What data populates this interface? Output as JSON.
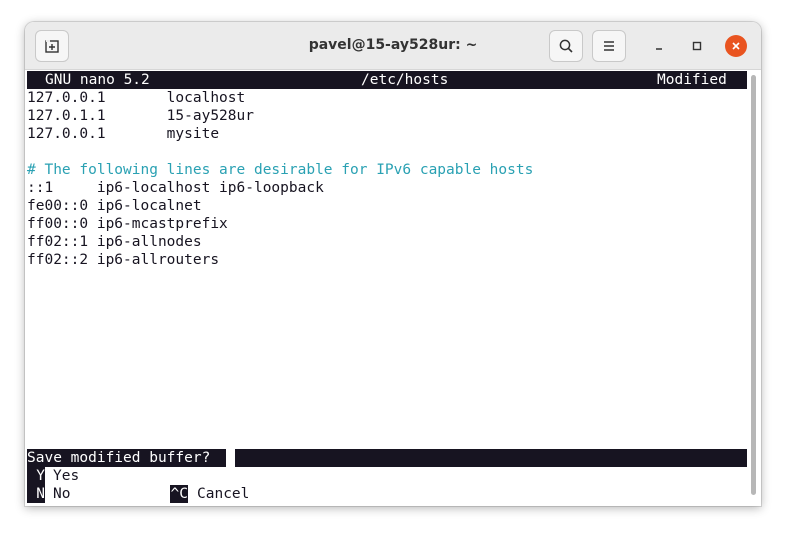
{
  "window": {
    "title": "pavel@15-ay528ur: ~"
  },
  "nano": {
    "version": "GNU nano 5.2",
    "filename": "/etc/hosts",
    "status": "Modified",
    "lines": [
      "127.0.0.1       localhost",
      "127.0.1.1       15-ay528ur",
      "127.0.0.1       mysite",
      "",
      "# The following lines are desirable for IPv6 capable hosts",
      "::1     ip6-localhost ip6-loopback",
      "fe00::0 ip6-localnet",
      "ff00::0 ip6-mcastprefix",
      "ff02::1 ip6-allnodes",
      "ff02::2 ip6-allrouters"
    ],
    "prompt": "Save modified buffer?",
    "options": [
      {
        "key": "Y",
        "label": "Yes"
      },
      {
        "key": "N",
        "label": "No"
      },
      {
        "key": "^C",
        "label": "Cancel"
      }
    ]
  },
  "colors": {
    "comment": "#2aa1b3",
    "close_button": "#e95420",
    "terminal_fg": "#171421"
  },
  "icons": {
    "new_tab": "new-tab-icon",
    "search": "search-icon",
    "menu": "hamburger-menu-icon",
    "minimize": "minimize-icon",
    "maximize": "maximize-icon",
    "close": "close-icon"
  }
}
